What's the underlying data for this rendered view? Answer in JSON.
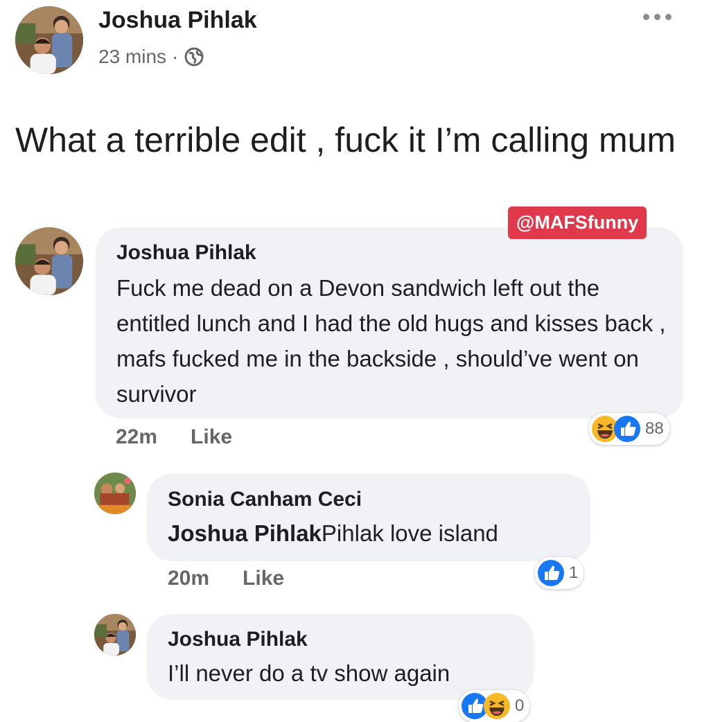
{
  "post": {
    "author": "Joshua Pihlak",
    "time": "23 mins",
    "separator": "·",
    "text": "What a terrible edit , fuck it I’m calling mum",
    "privacy_icon": "globe-icon",
    "more_icon": "more-options-icon"
  },
  "watermark": "@MAFSfunny",
  "comments": [
    {
      "author": "Joshua Pihlak",
      "text": "Fuck me dead on a Devon sandwich left out the entitled lunch and I had the old hugs and kisses back , mafs fucked me in the backside , should’ve went on survivor",
      "time": "22m",
      "like_label": "Like",
      "reaction_count": "88",
      "reactions": [
        "haha-icon",
        "like-icon"
      ]
    },
    {
      "author": "Sonia Canham Ceci",
      "mention": "Joshua Pihlak",
      "text": "Pihlak love island",
      "time": "20m",
      "like_label": "Like",
      "reaction_count": "1",
      "reactions": [
        "like-icon"
      ]
    },
    {
      "author": "Joshua Pihlak",
      "text": "I’ll never do a tv show again",
      "reaction_count": "0",
      "reactions": [
        "like-icon",
        "haha-icon"
      ]
    }
  ],
  "colors": {
    "bubble": "#f0f2f5",
    "secondary_text": "#65676b",
    "like_blue": "#1877f2",
    "haha_yellow": "#f7b928",
    "watermark_red": "#e0394b"
  }
}
